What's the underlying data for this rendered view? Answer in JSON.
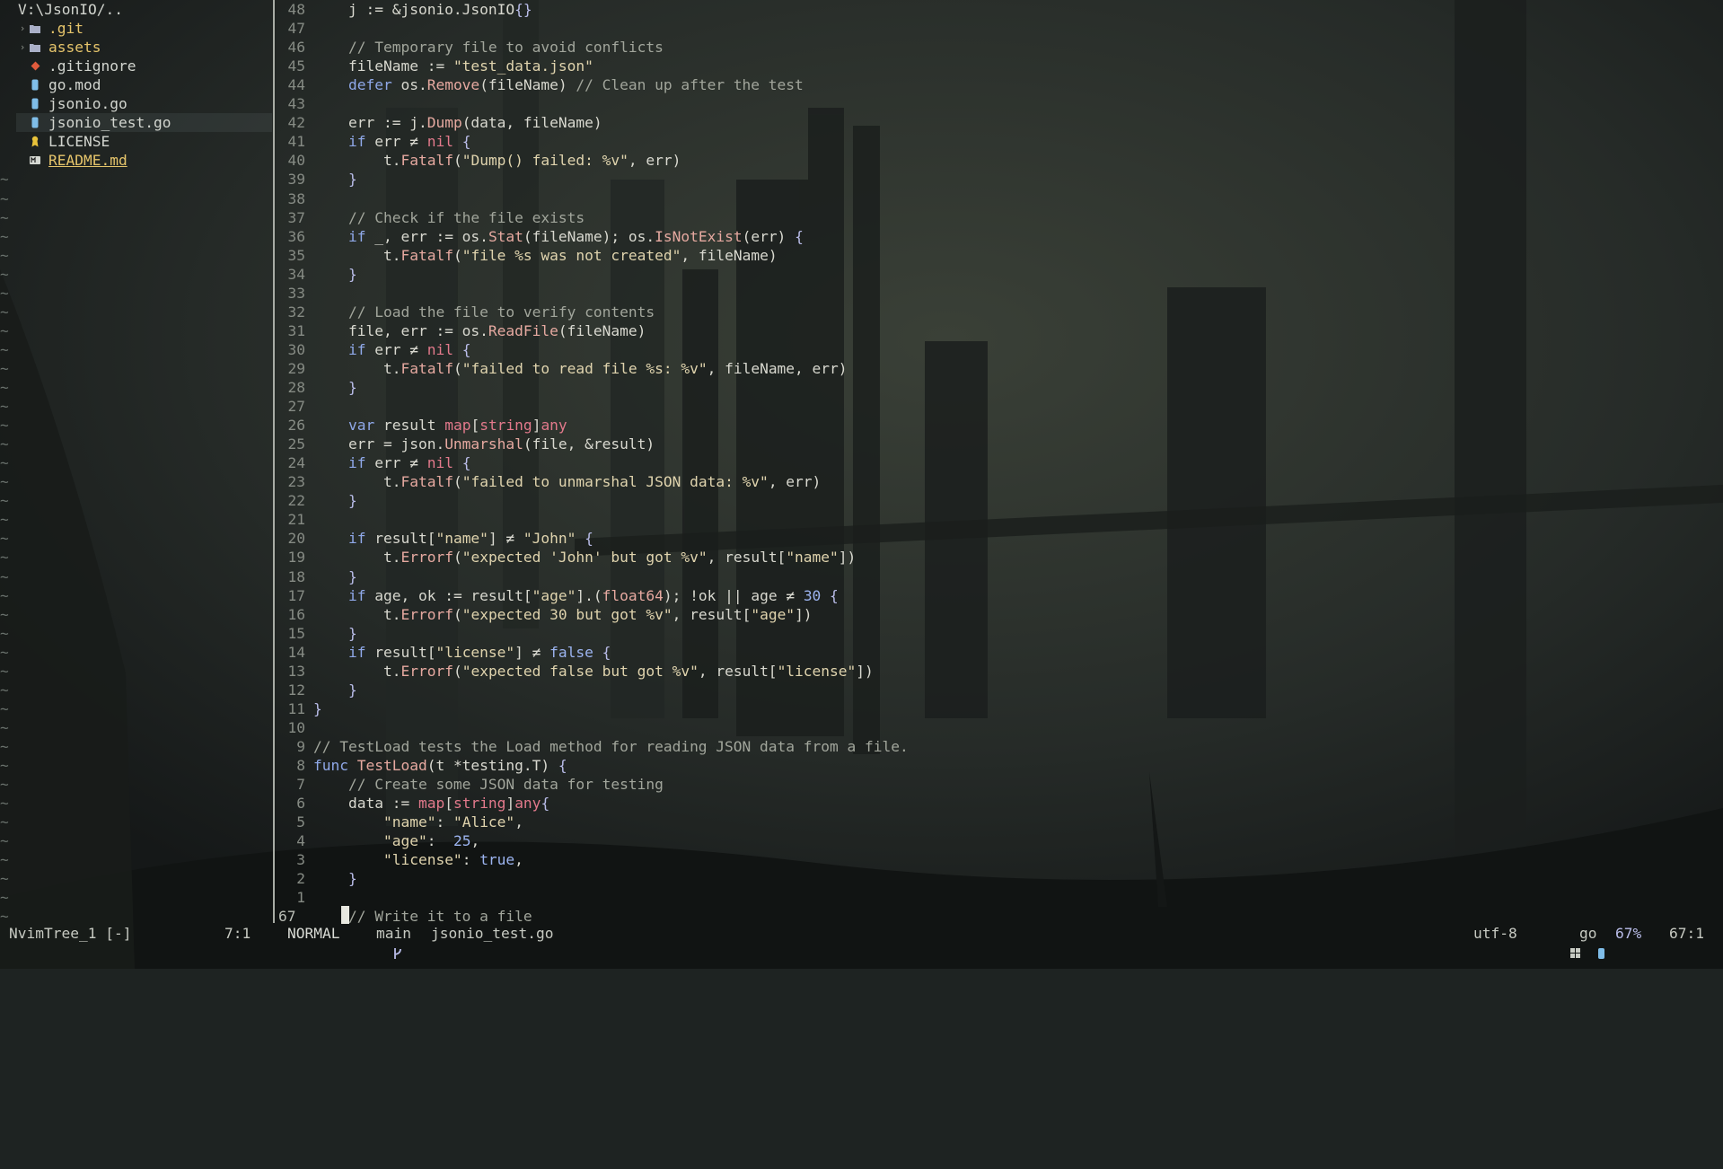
{
  "tree": {
    "root_path": "V:\\JsonIO/..",
    "items": [
      {
        "label": ".git",
        "kind": "folder",
        "chevron": "›",
        "label_color": "#e5c46b",
        "icon": "folder-icon",
        "icon_color": "#aab0c8",
        "selected": false,
        "underline": false
      },
      {
        "label": "assets",
        "kind": "folder",
        "chevron": "›",
        "label_color": "#e5c46b",
        "icon": "folder-icon",
        "icon_color": "#aab0c8",
        "selected": false,
        "underline": false
      },
      {
        "label": ".gitignore",
        "kind": "file",
        "chevron": "",
        "label_color": "#d2d5cf",
        "icon": "git-icon",
        "icon_color": "#e15b3d",
        "selected": false,
        "underline": false
      },
      {
        "label": "go.mod",
        "kind": "file",
        "chevron": "",
        "label_color": "#d2d5cf",
        "icon": "go-file-icon",
        "icon_color": "#7fbde8",
        "selected": false,
        "underline": false
      },
      {
        "label": "jsonio.go",
        "kind": "file",
        "chevron": "",
        "label_color": "#d2d5cf",
        "icon": "go-file-icon",
        "icon_color": "#7fbde8",
        "selected": false,
        "underline": false
      },
      {
        "label": "jsonio_test.go",
        "kind": "file",
        "chevron": "",
        "label_color": "#d2d5cf",
        "icon": "go-file-icon",
        "icon_color": "#7fbde8",
        "selected": true,
        "underline": false
      },
      {
        "label": "LICENSE",
        "kind": "file",
        "chevron": "",
        "label_color": "#d2d5cf",
        "icon": "license-icon",
        "icon_color": "#e8c23a",
        "selected": false,
        "underline": false
      },
      {
        "label": "README.md",
        "kind": "file",
        "chevron": "",
        "label_color": "#e5c46b",
        "icon": "markdown-icon",
        "icon_color": "#d5d8d2",
        "selected": false,
        "underline": true
      }
    ],
    "filler_char": "~",
    "filler_rows": 40
  },
  "editor": {
    "lines": [
      {
        "n": "48",
        "t": [
          [
            "    j := &jsonio.JsonIO",
            ""
          ],
          [
            "{}",
            "br"
          ]
        ]
      },
      {
        "n": "47",
        "t": []
      },
      {
        "n": "46",
        "t": [
          [
            "    // Temporary file to avoid conflicts",
            "cm"
          ]
        ]
      },
      {
        "n": "45",
        "t": [
          [
            "    fileName := ",
            ""
          ],
          [
            "\"test_data.json\"",
            "str"
          ]
        ]
      },
      {
        "n": "44",
        "t": [
          [
            "    ",
            ""
          ],
          [
            "defer",
            "kw"
          ],
          [
            " os.",
            ""
          ],
          [
            "Remove",
            "fn"
          ],
          [
            "(fileName) ",
            ""
          ],
          [
            "// Clean up after the test",
            "cm"
          ]
        ]
      },
      {
        "n": "43",
        "t": []
      },
      {
        "n": "42",
        "t": [
          [
            "    err := j.",
            ""
          ],
          [
            "Dump",
            "fn"
          ],
          [
            "(data, fileName)",
            ""
          ]
        ]
      },
      {
        "n": "41",
        "t": [
          [
            "    ",
            ""
          ],
          [
            "if",
            "kw"
          ],
          [
            " err ≠ ",
            ""
          ],
          [
            "nil",
            "ty"
          ],
          [
            " {",
            "br"
          ]
        ]
      },
      {
        "n": "40",
        "t": [
          [
            "        t.",
            ""
          ],
          [
            "Fatalf",
            "fn"
          ],
          [
            "(",
            ""
          ],
          [
            "\"Dump() failed: %v\"",
            "str"
          ],
          [
            ", err)",
            ""
          ]
        ]
      },
      {
        "n": "39",
        "t": [
          [
            "    }",
            "br"
          ]
        ]
      },
      {
        "n": "38",
        "t": []
      },
      {
        "n": "37",
        "t": [
          [
            "    // Check if the file exists",
            "cm"
          ]
        ]
      },
      {
        "n": "36",
        "t": [
          [
            "    ",
            ""
          ],
          [
            "if",
            "kw"
          ],
          [
            " _, err := os.",
            ""
          ],
          [
            "Stat",
            "fn"
          ],
          [
            "(fileName); os.",
            ""
          ],
          [
            "IsNotExist",
            "fn"
          ],
          [
            "(err) ",
            ""
          ],
          [
            "{",
            "br"
          ]
        ]
      },
      {
        "n": "35",
        "t": [
          [
            "        t.",
            ""
          ],
          [
            "Fatalf",
            "fn"
          ],
          [
            "(",
            ""
          ],
          [
            "\"file %s was not created\"",
            "str"
          ],
          [
            ", fileName)",
            ""
          ]
        ]
      },
      {
        "n": "34",
        "t": [
          [
            "    }",
            "br"
          ]
        ]
      },
      {
        "n": "33",
        "t": []
      },
      {
        "n": "32",
        "t": [
          [
            "    // Load the file to verify contents",
            "cm"
          ]
        ]
      },
      {
        "n": "31",
        "t": [
          [
            "    file, err := os.",
            ""
          ],
          [
            "ReadFile",
            "fn"
          ],
          [
            "(fileName)",
            ""
          ]
        ]
      },
      {
        "n": "30",
        "t": [
          [
            "    ",
            ""
          ],
          [
            "if",
            "kw"
          ],
          [
            " err ≠ ",
            ""
          ],
          [
            "nil",
            "ty"
          ],
          [
            " {",
            "br"
          ]
        ]
      },
      {
        "n": "29",
        "t": [
          [
            "        t.",
            ""
          ],
          [
            "Fatalf",
            "fn"
          ],
          [
            "(",
            ""
          ],
          [
            "\"failed to read file %s: %v\"",
            "str"
          ],
          [
            ", fileName, err)",
            ""
          ]
        ]
      },
      {
        "n": "28",
        "t": [
          [
            "    }",
            "br"
          ]
        ]
      },
      {
        "n": "27",
        "t": []
      },
      {
        "n": "26",
        "t": [
          [
            "    ",
            ""
          ],
          [
            "var",
            "kw"
          ],
          [
            " result ",
            ""
          ],
          [
            "map",
            "ty"
          ],
          [
            "[",
            ""
          ],
          [
            "string",
            "ty"
          ],
          [
            "]",
            ""
          ],
          [
            "any",
            "ty"
          ]
        ]
      },
      {
        "n": "25",
        "t": [
          [
            "    err = json.",
            ""
          ],
          [
            "Unmarshal",
            "fn"
          ],
          [
            "(file, &result)",
            ""
          ]
        ]
      },
      {
        "n": "24",
        "t": [
          [
            "    ",
            ""
          ],
          [
            "if",
            "kw"
          ],
          [
            " err ≠ ",
            ""
          ],
          [
            "nil",
            "ty"
          ],
          [
            " {",
            "br"
          ]
        ]
      },
      {
        "n": "23",
        "t": [
          [
            "        t.",
            ""
          ],
          [
            "Fatalf",
            "fn"
          ],
          [
            "(",
            ""
          ],
          [
            "\"failed to unmarshal JSON data: %v\"",
            "str"
          ],
          [
            ", err)",
            ""
          ]
        ]
      },
      {
        "n": "22",
        "t": [
          [
            "    }",
            "br"
          ]
        ]
      },
      {
        "n": "21",
        "t": []
      },
      {
        "n": "20",
        "t": [
          [
            "    ",
            ""
          ],
          [
            "if",
            "kw"
          ],
          [
            " result[",
            ""
          ],
          [
            "\"name\"",
            "str"
          ],
          [
            "] ≠ ",
            ""
          ],
          [
            "\"John\"",
            "str"
          ],
          [
            " {",
            "br"
          ]
        ]
      },
      {
        "n": "19",
        "t": [
          [
            "        t.",
            ""
          ],
          [
            "Errorf",
            "fn"
          ],
          [
            "(",
            ""
          ],
          [
            "\"expected 'John' but got %v\"",
            "str"
          ],
          [
            ", result[",
            ""
          ],
          [
            "\"name\"",
            "str"
          ],
          [
            "])",
            ""
          ]
        ]
      },
      {
        "n": "18",
        "t": [
          [
            "    }",
            "br"
          ]
        ]
      },
      {
        "n": "17",
        "t": [
          [
            "    ",
            ""
          ],
          [
            "if",
            "kw"
          ],
          [
            " age, ok := result[",
            ""
          ],
          [
            "\"age\"",
            "str"
          ],
          [
            "].(",
            ""
          ],
          [
            "float64",
            "fn"
          ],
          [
            "); !ok || age ≠ ",
            ""
          ],
          [
            "30",
            "num"
          ],
          [
            " {",
            "br"
          ]
        ]
      },
      {
        "n": "16",
        "t": [
          [
            "        t.",
            ""
          ],
          [
            "Errorf",
            "fn"
          ],
          [
            "(",
            ""
          ],
          [
            "\"expected 30 but got %v\"",
            "str"
          ],
          [
            ", result[",
            ""
          ],
          [
            "\"age\"",
            "str"
          ],
          [
            "])",
            ""
          ]
        ]
      },
      {
        "n": "15",
        "t": [
          [
            "    }",
            "br"
          ]
        ]
      },
      {
        "n": "14",
        "t": [
          [
            "    ",
            ""
          ],
          [
            "if",
            "kw"
          ],
          [
            " result[",
            ""
          ],
          [
            "\"license\"",
            "str"
          ],
          [
            "] ≠ ",
            ""
          ],
          [
            "false",
            "num"
          ],
          [
            " {",
            "br"
          ]
        ]
      },
      {
        "n": "13",
        "t": [
          [
            "        t.",
            ""
          ],
          [
            "Errorf",
            "fn"
          ],
          [
            "(",
            ""
          ],
          [
            "\"expected false but got %v\"",
            "str"
          ],
          [
            ", result[",
            ""
          ],
          [
            "\"license\"",
            "str"
          ],
          [
            "])",
            ""
          ]
        ]
      },
      {
        "n": "12",
        "t": [
          [
            "    }",
            "br"
          ]
        ]
      },
      {
        "n": "11",
        "t": [
          [
            "}",
            "br"
          ]
        ]
      },
      {
        "n": "10",
        "t": []
      },
      {
        "n": "9",
        "t": [
          [
            "// TestLoad tests the Load method for reading JSON data from a file.",
            "cm"
          ]
        ]
      },
      {
        "n": "8",
        "t": [
          [
            "func",
            "kw"
          ],
          [
            " ",
            ""
          ],
          [
            "TestLoad",
            "fn"
          ],
          [
            "(t *testing.T) ",
            ""
          ],
          [
            "{",
            "br"
          ]
        ]
      },
      {
        "n": "7",
        "t": [
          [
            "    // Create some JSON data for testing",
            "cm"
          ]
        ]
      },
      {
        "n": "6",
        "t": [
          [
            "    data := ",
            ""
          ],
          [
            "map",
            "ty"
          ],
          [
            "[",
            ""
          ],
          [
            "string",
            "ty"
          ],
          [
            "]",
            ""
          ],
          [
            "any",
            "ty"
          ],
          [
            "{",
            "br"
          ]
        ]
      },
      {
        "n": "5",
        "t": [
          [
            "        ",
            ""
          ],
          [
            "\"name\"",
            "str"
          ],
          [
            ": ",
            ""
          ],
          [
            "\"Alice\"",
            "str"
          ],
          [
            ",",
            ""
          ]
        ]
      },
      {
        "n": "4",
        "t": [
          [
            "        ",
            ""
          ],
          [
            "\"age\"",
            "str"
          ],
          [
            ":  ",
            ""
          ],
          [
            "25",
            "num"
          ],
          [
            ",",
            ""
          ]
        ]
      },
      {
        "n": "3",
        "t": [
          [
            "        ",
            ""
          ],
          [
            "\"license\"",
            "str"
          ],
          [
            ": ",
            ""
          ],
          [
            "true",
            "num"
          ],
          [
            ",",
            ""
          ]
        ]
      },
      {
        "n": "2",
        "t": [
          [
            "    }",
            "br"
          ]
        ]
      },
      {
        "n": "1",
        "t": []
      },
      {
        "n": "67",
        "cur": true,
        "t": [
          [
            "    // Write it to a file",
            "cm"
          ]
        ]
      }
    ]
  },
  "statusline": {
    "tree_name": "NvimTree_1 [-]",
    "tree_pos": "7:1",
    "mode": "NORMAL",
    "branch_icon": "git-branch-icon",
    "branch": "main",
    "filename": "jsonio_test.go",
    "encoding": "utf-8",
    "os_icon": "windows-icon",
    "ft_icon": "go-file-icon",
    "filetype": "go",
    "percent": "67%",
    "position": "67:1"
  }
}
